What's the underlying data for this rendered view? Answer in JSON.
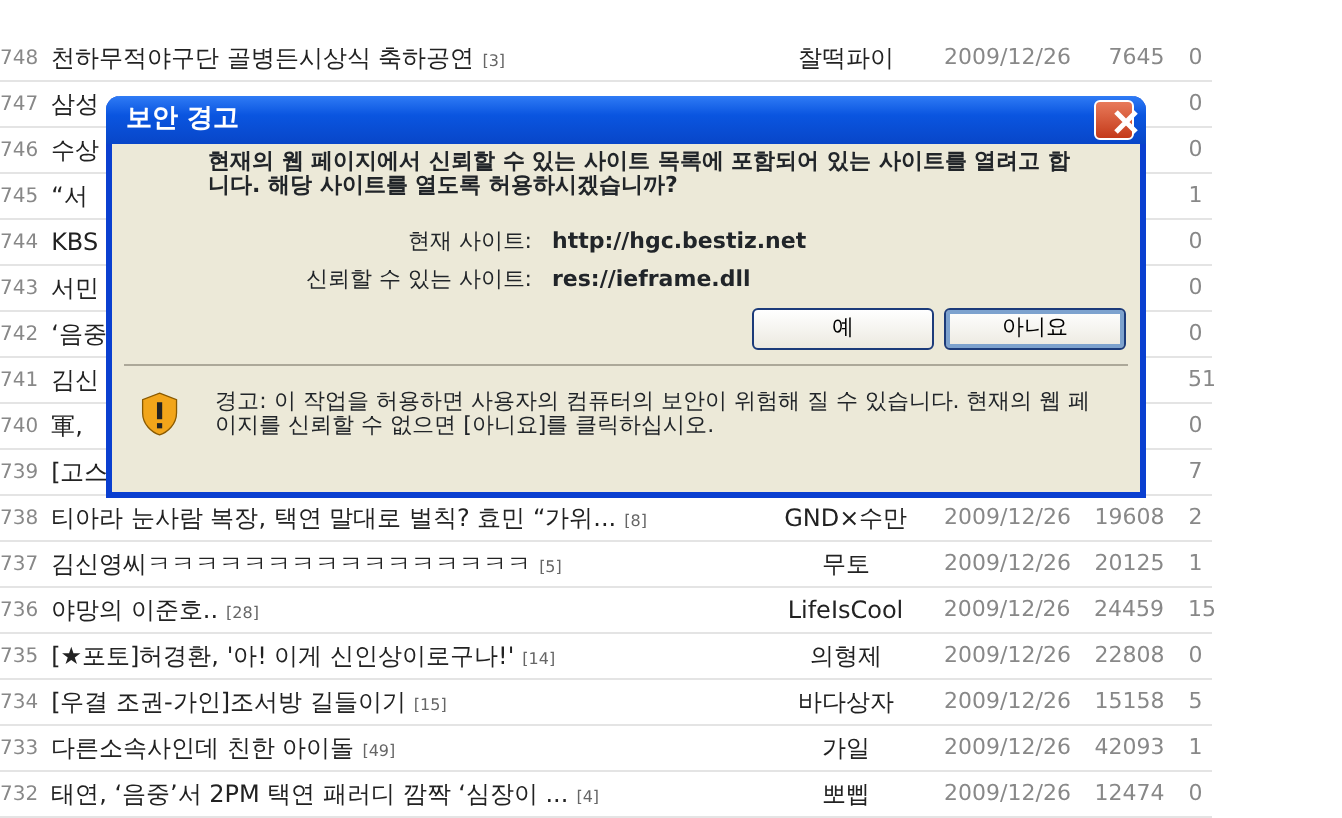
{
  "posts": [
    {
      "no": "748",
      "title": "천하무적야구단 골병든시상식 축하공연",
      "comments": "[3]",
      "author": "찰떡파이",
      "date": "2009/12/26",
      "views": "7645",
      "replies": "0"
    },
    {
      "no": "747",
      "title": "삼성",
      "replies": "0"
    },
    {
      "no": "746",
      "title": "수상",
      "replies": "0"
    },
    {
      "no": "745",
      "title": "“서",
      "replies": "1"
    },
    {
      "no": "744",
      "title": "KBS",
      "replies": "0"
    },
    {
      "no": "743",
      "title": "서민",
      "replies": "0"
    },
    {
      "no": "742",
      "title": "‘음중",
      "replies": "0"
    },
    {
      "no": "741",
      "title": "김신",
      "replies": "51"
    },
    {
      "no": "740",
      "title": "軍,",
      "replies": "0"
    },
    {
      "no": "739",
      "title": "[고스",
      "replies": "7"
    },
    {
      "no": "738",
      "title": "티아라 눈사람 복장, 택연 말대로 벌칙? 효민 “가위...",
      "comments": "[8]",
      "author": "GND×수만",
      "date": "2009/12/26",
      "views": "19608",
      "replies": "2"
    },
    {
      "no": "737",
      "title": "김신영씨ㅋㅋㅋㅋㅋㅋㅋㅋㅋㅋㅋㅋㅋㅋㅋㅋ",
      "comments": "[5]",
      "author": "무토",
      "date": "2009/12/26",
      "views": "20125",
      "replies": "1"
    },
    {
      "no": "736",
      "title": "야망의 이준호..",
      "comments": "[28]",
      "author": "LifeIsCool",
      "date": "2009/12/26",
      "views": "24459",
      "replies": "15"
    },
    {
      "no": "735",
      "title": "[★포토]허경환, '아! 이게 신인상이로구나!'",
      "comments": "[14]",
      "author": "의형제",
      "date": "2009/12/26",
      "views": "22808",
      "replies": "0"
    },
    {
      "no": "734",
      "title": "[우결 조권-가인]조서방 길들이기",
      "comments": "[15]",
      "author": "바다상자",
      "date": "2009/12/26",
      "views": "15158",
      "replies": "5"
    },
    {
      "no": "733",
      "title": "다른소속사인데 친한 아이돌",
      "comments": "[49]",
      "author": "가일",
      "date": "2009/12/26",
      "views": "42093",
      "replies": "1"
    },
    {
      "no": "732",
      "title": "태연, ‘음중’서 2PM 택연 패러디 깜짝 ‘심장이 ...",
      "comments": "[4]",
      "author": "뽀삡",
      "date": "2009/12/26",
      "views": "12474",
      "replies": "0"
    }
  ],
  "dialog": {
    "title": "보안 경고",
    "message": "현재의 웹 페이지에서 신뢰할 수 있는 사이트 목록에 포함되어 있는 사이트를 열려고 합니다. 해당 사이트를 열도록 허용하시겠습니까?",
    "fields": [
      {
        "label": "현재 사이트:",
        "value": "http://hgc.bestiz.net"
      },
      {
        "label": "신뢰할 수 있는 사이트:",
        "value": "res://ieframe.dll"
      }
    ],
    "buttons": [
      {
        "label": "예",
        "selected": false
      },
      {
        "label": "아니요",
        "selected": true
      }
    ],
    "warning": "경고: 이 작업을 허용하면 사용자의 컴퓨터의 보안이 위험해 질 수 있습니다. 현재의 웹 페이지를 신뢰할 수 없으면 [아니요]를 클릭하십시오."
  }
}
